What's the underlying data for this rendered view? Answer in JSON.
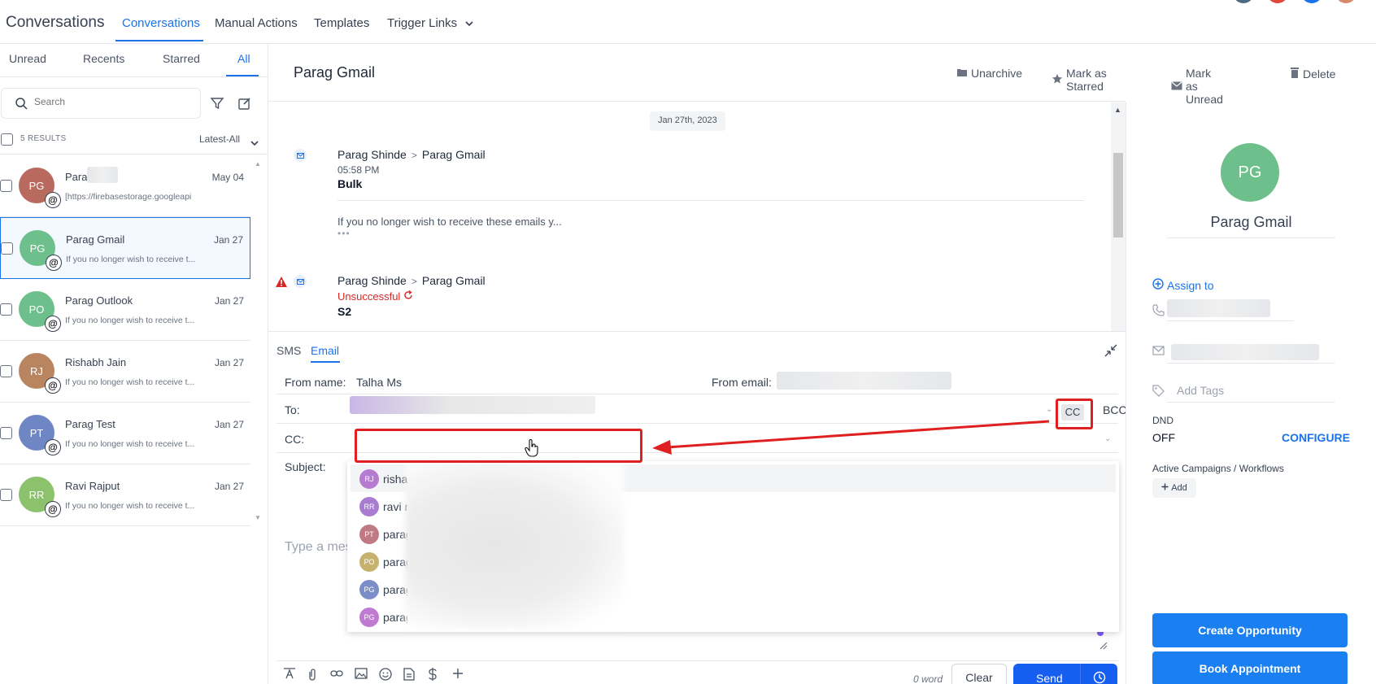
{
  "topnav": {
    "brand": "Conversations",
    "items": [
      "Conversations",
      "Manual Actions",
      "Templates",
      "Trigger Links"
    ]
  },
  "left": {
    "tabs": [
      "Unread",
      "Recents",
      "Starred",
      "All"
    ],
    "search_placeholder": "Search",
    "results": "5 RESULTS",
    "sort": "Latest-All",
    "conversations": [
      {
        "initials": "PG",
        "name": "Para",
        "date": "May 04",
        "snippet": "[https://firebasestorage.googleapi",
        "color": "#b96a5e"
      },
      {
        "initials": "PG",
        "name": "Parag Gmail",
        "date": "Jan 27",
        "snippet": "If you no longer wish to receive t...",
        "color": "#6dbf8b"
      },
      {
        "initials": "PO",
        "name": "Parag Outlook",
        "date": "Jan 27",
        "snippet": "If you no longer wish to receive t...",
        "color": "#6dbf8b"
      },
      {
        "initials": "RJ",
        "name": "Rishabh Jain",
        "date": "Jan 27",
        "snippet": "If you no longer wish to receive t...",
        "color": "#b98560"
      },
      {
        "initials": "PT",
        "name": "Parag Test",
        "date": "Jan 27",
        "snippet": "If you no longer wish to receive t...",
        "color": "#6f86c5"
      },
      {
        "initials": "RR",
        "name": "Ravi Rajput",
        "date": "Jan 27",
        "snippet": "If you no longer wish to receive t...",
        "color": "#8bc26b"
      }
    ]
  },
  "middle": {
    "title": "Parag Gmail",
    "actions": [
      "Unarchive",
      "Mark as Starred",
      "Mark as Unread",
      "Delete"
    ],
    "date_pill": "Jan 27th, 2023",
    "messages": [
      {
        "from": "Parag Shinde",
        "sep": ">",
        "to": "Parag Gmail",
        "time": "05:58 PM",
        "subject": "Bulk",
        "body": "If you no longer wish to receive these emails y..."
      },
      {
        "from": "Parag Shinde",
        "sep": ">",
        "to": "Parag Gmail",
        "status": "Unsuccessful",
        "subject": "S2"
      }
    ],
    "composer": {
      "tabs": [
        "SMS",
        "Email"
      ],
      "from_name_label": "From name:",
      "from_name_value": "Talha Ms",
      "from_email_label": "From email:",
      "to_label": "To:",
      "cc_button": "CC",
      "bcc_button": "BCC",
      "cc_label": "CC:",
      "subject_label": "Subject:",
      "message_placeholder": "Type a mes",
      "word_count": "0 word",
      "clear": "Clear",
      "send": "Send"
    },
    "dropdown": [
      {
        "initials": "RJ",
        "name": "risha",
        "color": "#b57bd1"
      },
      {
        "initials": "RR",
        "name": "ravi r",
        "color": "#a87cd0"
      },
      {
        "initials": "PT",
        "name": "parag",
        "color": "#c07a84"
      },
      {
        "initials": "PO",
        "name": "parag",
        "color": "#c7b26d"
      },
      {
        "initials": "PG",
        "name": "parag",
        "color": "#7b8ec7"
      },
      {
        "initials": "PG",
        "name": "parag",
        "color": "#c07ad1"
      }
    ]
  },
  "right": {
    "initials": "PG",
    "name": "Parag Gmail",
    "assign": "Assign to",
    "add_tags": "Add Tags",
    "dnd_label": "DND",
    "dnd_value": "OFF",
    "configure": "CONFIGURE",
    "campaigns": "Active Campaigns / Workflows",
    "add": "Add",
    "create_opportunity": "Create Opportunity",
    "book_appointment": "Book Appointment"
  },
  "colors": {
    "accent": "#1a73e8",
    "annotation": "#e02020"
  }
}
